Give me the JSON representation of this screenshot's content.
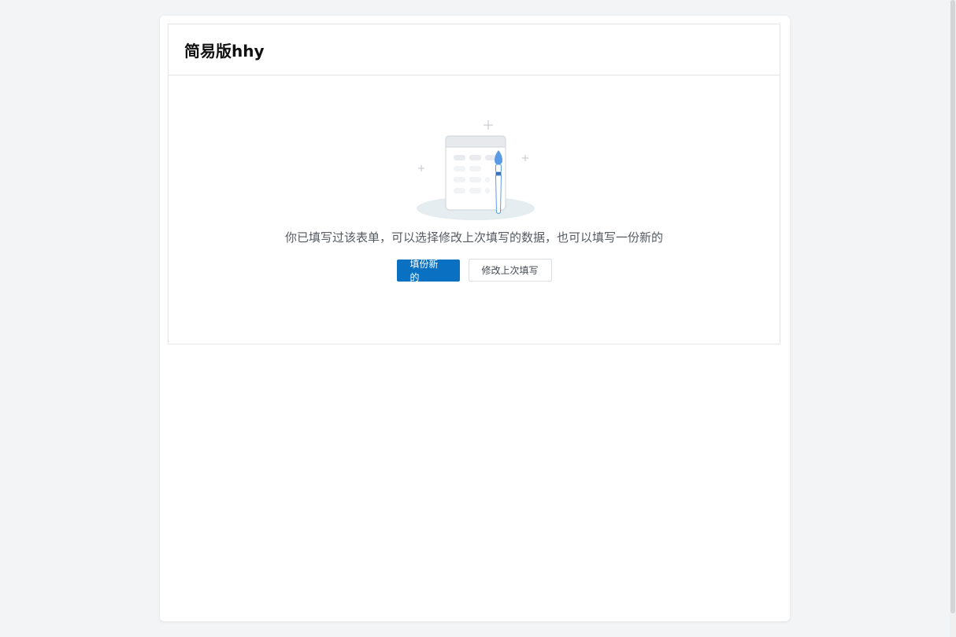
{
  "form": {
    "title": "简易版hhy"
  },
  "empty_state": {
    "illustration_icon": "form-calendar-paintbrush-icon",
    "message": "你已填写过该表单，可以选择修改上次填写的数据，也可以填写一份新的"
  },
  "actions": {
    "new_fill_label": "填份新的",
    "edit_last_label": "修改上次填写"
  },
  "colors": {
    "primary": "#0a70c2",
    "background": "#f3f4f6",
    "border": "#e3e5e8",
    "text_muted": "#555a61"
  }
}
